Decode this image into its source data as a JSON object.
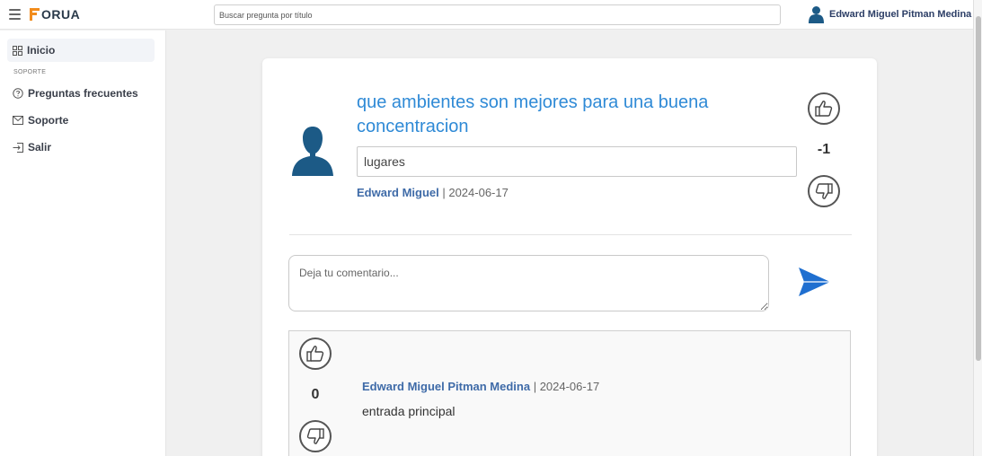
{
  "header": {
    "logo_text": "ORUA",
    "search_placeholder": "Buscar pregunta por título",
    "user_name": "Edward Miguel Pitman Medina"
  },
  "sidebar": {
    "items": [
      {
        "label": "Inicio",
        "icon": "grid-icon",
        "active": true
      },
      {
        "label": "Preguntas frecuentes",
        "icon": "question-circle-icon",
        "active": false
      },
      {
        "label": "Soporte",
        "icon": "envelope-icon",
        "active": false
      },
      {
        "label": "Salir",
        "icon": "logout-icon",
        "active": false
      }
    ],
    "section_label": "SOPORTE"
  },
  "question": {
    "title": "que ambientes son mejores para una buena concentracion",
    "tag": "lugares",
    "author": "Edward Miguel",
    "separator": " | ",
    "date": "2024-06-17",
    "score": "-1"
  },
  "comment_form": {
    "placeholder": "Deja tu comentario..."
  },
  "comments": [
    {
      "author": "Edward Miguel Pitman Medina",
      "separator": " | ",
      "date": "2024-06-17",
      "body": "entrada principal",
      "score": "0"
    }
  ],
  "colors": {
    "accent": "#2f8ad6",
    "author": "#3f6ba8",
    "logo_orange": "#f28c1c",
    "send": "#1f6fd0",
    "avatar": "#1c5a86"
  }
}
